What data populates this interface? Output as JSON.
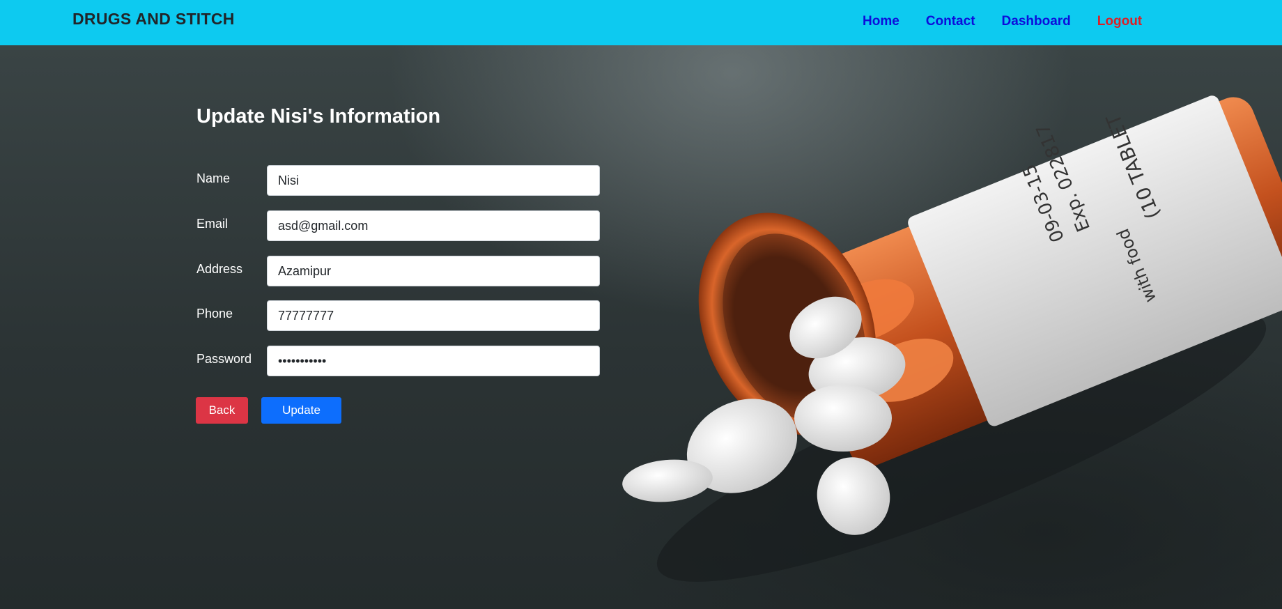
{
  "navbar": {
    "brand": "DRUGS AND STITCH",
    "links": [
      {
        "label": "Home"
      },
      {
        "label": "Contact"
      },
      {
        "label": "Dashboard"
      },
      {
        "label": "Logout"
      }
    ]
  },
  "form": {
    "title": "Update Nisi's Information",
    "fields": [
      {
        "label": "Name",
        "value": "Nisi",
        "type": "text"
      },
      {
        "label": "Email",
        "value": "asd@gmail.com",
        "type": "email"
      },
      {
        "label": "Address",
        "value": "Azamipur",
        "type": "text"
      },
      {
        "label": "Phone",
        "value": "77777777",
        "type": "text"
      },
      {
        "label": "Password",
        "value": "aaaaaaaaaaa",
        "type": "password"
      }
    ],
    "back_label": "Back",
    "update_label": "Update"
  },
  "background": {
    "label_line_1": "09-03-15",
    "label_line_2": "Exp. 022817",
    "label_line_3": "(10 TABLET",
    "label_line_4": "with food"
  },
  "colors": {
    "navbar_bg": "#0dcaf0",
    "nav_link": "#0d0ddb",
    "logout": "#dc1f26",
    "back_button": "#dc3545",
    "update_button": "#0d6efd"
  }
}
